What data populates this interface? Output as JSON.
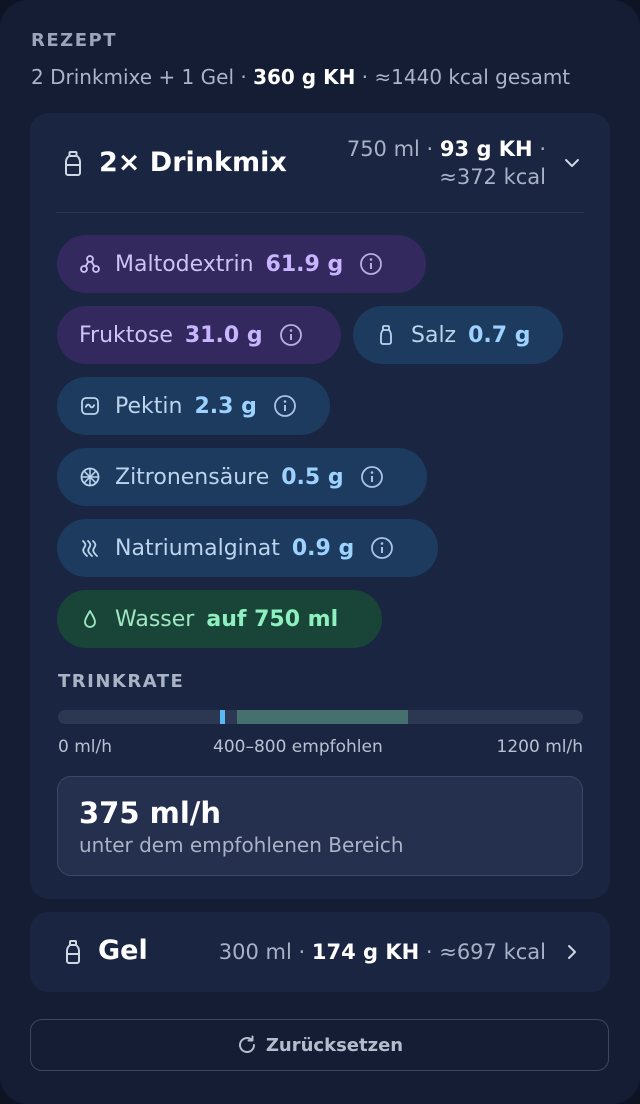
{
  "recipe": {
    "label": "REZEPT",
    "summary_prefix": "2 Drinkmixe + 1 Gel · ",
    "summary_carbs": "360 g KH",
    "summary_suffix": " · ≈1440 kcal gesamt"
  },
  "drinkmix": {
    "icon": "bottle-icon",
    "title": "2× Drinkmix",
    "volume": "750 ml · ",
    "carbs": "93 g KH",
    "sep": " ·",
    "kcal": "≈372 kcal",
    "expanded": true,
    "ingredients": [
      {
        "name": "Maltodextrin",
        "value": "61.9 g",
        "icon": "molecule-icon",
        "style": "purple",
        "info": true
      },
      {
        "name": "Fruktose",
        "value": "31.0 g",
        "icon": "",
        "style": "purple",
        "info": true
      },
      {
        "name": "Salz",
        "value": "0.7 g",
        "icon": "salt-shaker-icon",
        "style": "blue",
        "info": false
      },
      {
        "name": "Pektin",
        "value": "2.3 g",
        "icon": "wave-box-icon",
        "style": "blue",
        "info": true
      },
      {
        "name": "Zitronensäure",
        "value": "0.5 g",
        "icon": "citrus-icon",
        "style": "blue",
        "info": true
      },
      {
        "name": "Natriumalginat",
        "value": "0.9 g",
        "icon": "seaweed-icon",
        "style": "blue",
        "info": true
      },
      {
        "name": "Wasser",
        "value": "auf 750 ml",
        "icon": "droplet-icon",
        "style": "green",
        "info": false
      }
    ],
    "drink_rate": {
      "label": "TRINKRATE",
      "scale_min": 0,
      "scale_max": 1200,
      "recommended_min": 400,
      "recommended_max": 800,
      "current": 375,
      "tick_min": "0 ml/h",
      "tick_mid": "400–800 empfohlen",
      "tick_max": "1200 ml/h",
      "value": "375 ml/h",
      "note": "unter dem empfohlenen Bereich"
    }
  },
  "gel": {
    "icon": "gel-pack-icon",
    "title": "Gel",
    "volume": "300 ml · ",
    "carbs": "174 g KH",
    "kcal_text": " · ≈697 kcal",
    "expanded": false
  },
  "reset": {
    "icon": "refresh-icon",
    "label": "Zurücksetzen"
  },
  "colors": {
    "background": "#141d33",
    "card": "#1a2542",
    "purple_pill": "#33295f",
    "blue_pill": "#1d3a5f",
    "green_pill": "#184538",
    "rate_marker": "#5ab9f2",
    "rate_range": "#46706e"
  }
}
